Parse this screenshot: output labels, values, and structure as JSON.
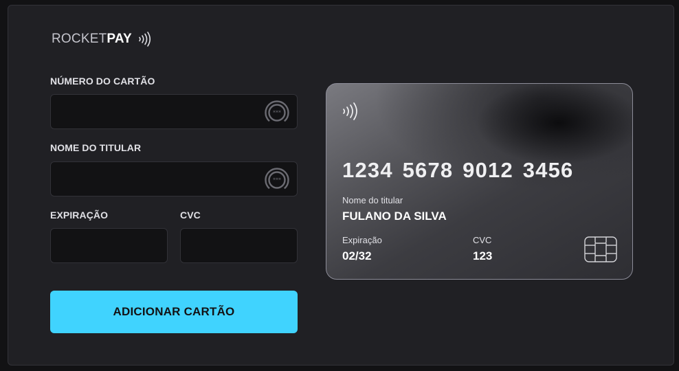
{
  "logo": {
    "part1": "ROCKET",
    "part2": "PAY",
    "icon": "contactless-icon"
  },
  "form": {
    "card_number": {
      "label": "NÚMERO DO CARTÃO",
      "value": "",
      "placeholder": "",
      "icon": "lock-badge-icon"
    },
    "holder_name": {
      "label": "NOME DO TITULAR",
      "value": "",
      "placeholder": "",
      "icon": "lock-badge-icon"
    },
    "expiration": {
      "label": "EXPIRAÇÃO",
      "value": "",
      "placeholder": ""
    },
    "cvc": {
      "label": "CVC",
      "value": "",
      "placeholder": ""
    },
    "submit_label": "ADICIONAR CARTÃO"
  },
  "card_preview": {
    "number": "1234 5678 9012 3456",
    "holder_label": "Nome do titular",
    "holder_value": "FULANO DA SILVA",
    "expiration_label": "Expiração",
    "expiration_value": "02/32",
    "cvc_label": "CVC",
    "cvc_value": "123",
    "icons": [
      "contactless-icon",
      "chip-icon"
    ]
  },
  "colors": {
    "background": "#121214",
    "panel": "#202024",
    "accent": "#40d3fe",
    "text": "#e1e1e6"
  }
}
